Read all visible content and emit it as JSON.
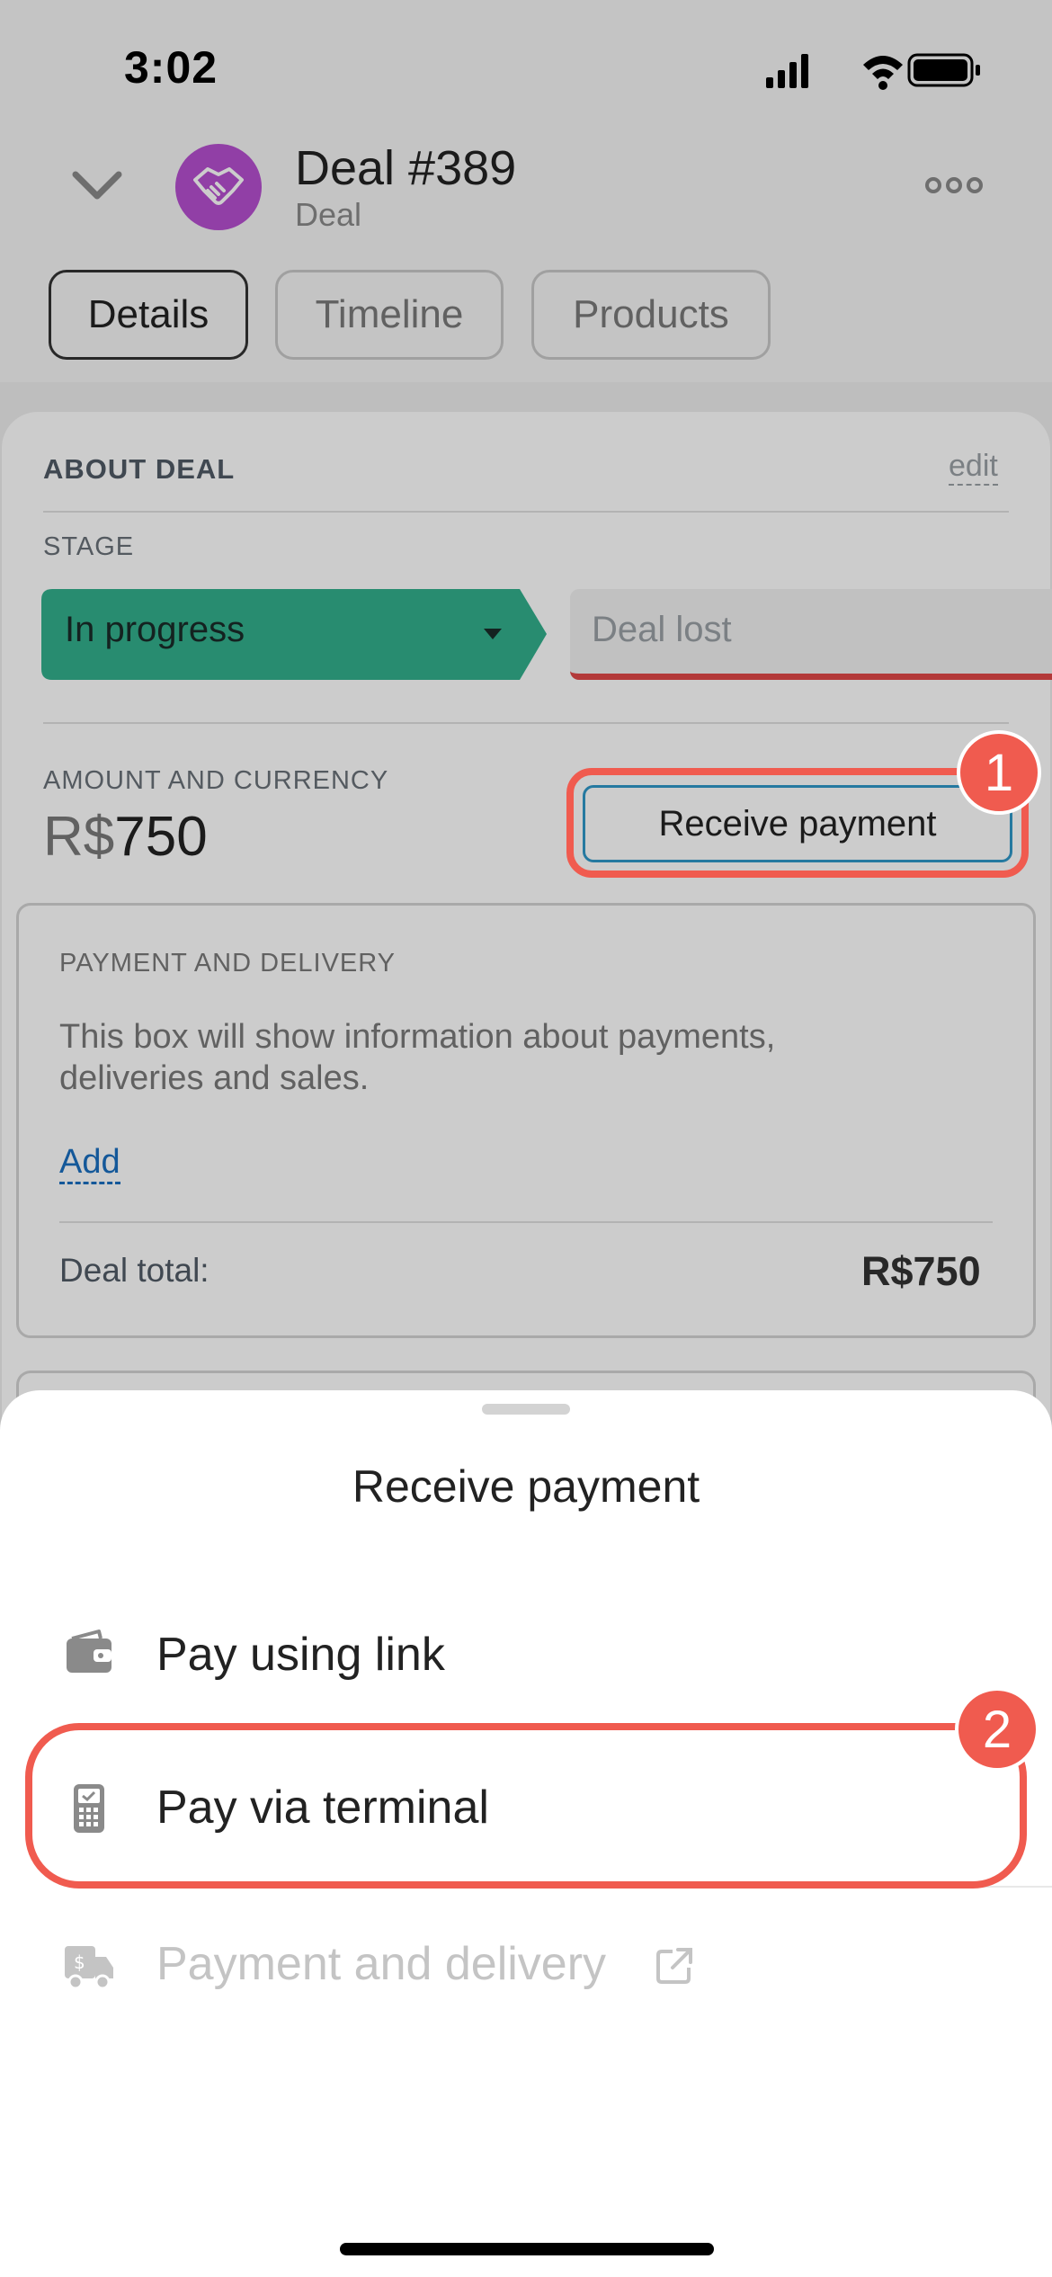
{
  "status_bar": {
    "time": "3:02"
  },
  "header": {
    "title": "Deal #389",
    "subtitle": "Deal",
    "tabs": [
      {
        "label": "Details",
        "active": true
      },
      {
        "label": "Timeline",
        "active": false
      },
      {
        "label": "Products",
        "active": false
      }
    ]
  },
  "about": {
    "section_title": "ABOUT DEAL",
    "edit_label": "edit",
    "stage_label": "STAGE",
    "stage_current": "In progress",
    "stage_current_color": "#32b08c",
    "stage_lost": "Deal lost",
    "amount_label": "AMOUNT AND CURRENCY",
    "amount_currency": "R$",
    "amount_value": "750",
    "receive_payment_button": "Receive payment"
  },
  "payment_delivery": {
    "title": "PAYMENT AND DELIVERY",
    "description": "This box will show information about payments, deliveries and sales.",
    "add_link": "Add",
    "total_label": "Deal total:",
    "total_value": "R$750"
  },
  "sheet": {
    "title": "Receive payment",
    "items": [
      {
        "label": "Pay using link",
        "icon": "wallet-icon",
        "enabled": true
      },
      {
        "label": "Pay via terminal",
        "icon": "terminal-icon",
        "enabled": true
      },
      {
        "label": "Payment and delivery",
        "icon": "delivery-truck-icon",
        "enabled": false
      }
    ]
  },
  "annotations": {
    "badge_1": "1",
    "badge_2": "2",
    "highlight_color": "#f05b4f"
  }
}
